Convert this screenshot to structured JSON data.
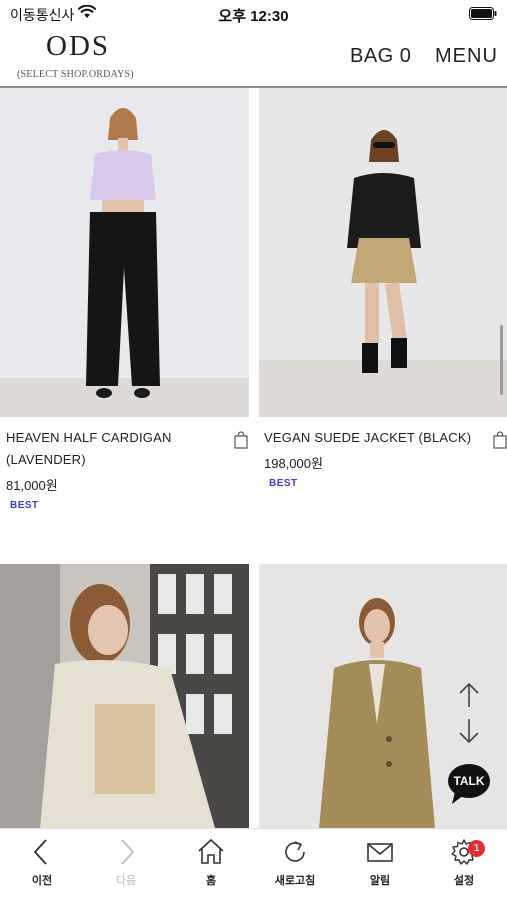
{
  "status_bar": {
    "carrier": "이동통신사",
    "time": "오후 12:30"
  },
  "header": {
    "logo": "ODS",
    "logo_sub": "(SELECT SHOP.ORDAYS)",
    "bag_label": "BAG 0",
    "menu_label": "MENU"
  },
  "products": [
    {
      "name": "HEAVEN HALF CARDIGAN (LAVENDER)",
      "price": "81,000원",
      "badge": "BEST"
    },
    {
      "name": "VEGAN SUEDE JACKET (BLACK)",
      "price": "198,000원",
      "badge": "BEST"
    }
  ],
  "floating": {
    "talk_label": "TALK"
  },
  "bottom_nav": {
    "back": "이전",
    "forward": "다음",
    "home": "홈",
    "refresh": "새로고침",
    "notifications": "알림",
    "settings": "설정",
    "settings_badge": "1"
  },
  "colors": {
    "badge_text": "#3b3bd6",
    "notification_badge": "#e52e2e",
    "divider": "#8c8c8c"
  }
}
